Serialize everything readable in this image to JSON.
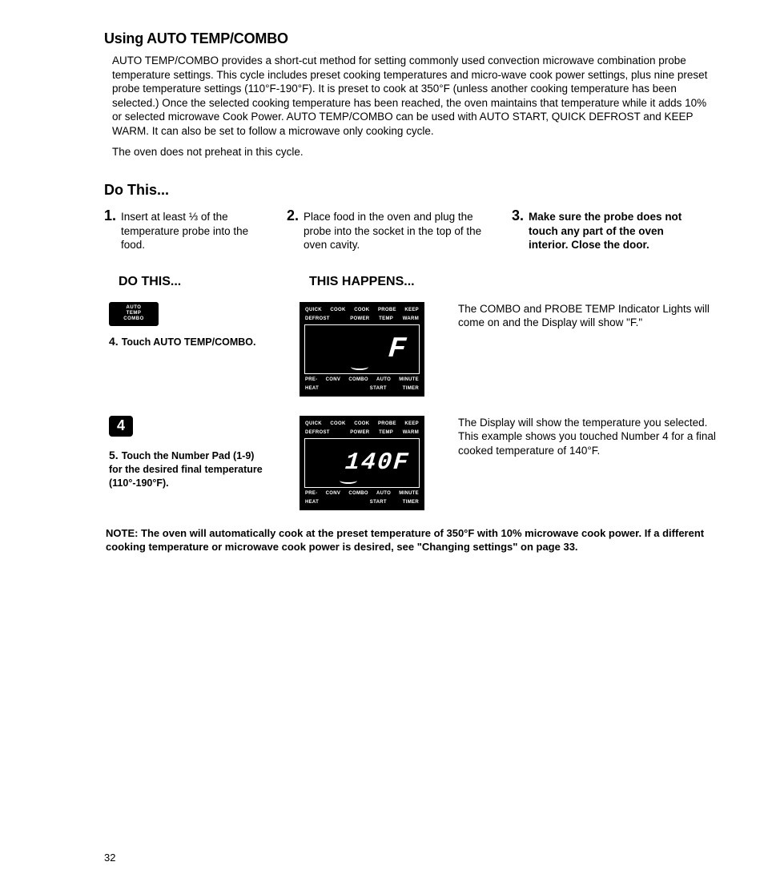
{
  "h1": "Using AUTO TEMP/COMBO",
  "intro": "AUTO TEMP/COMBO provides a short-cut method for setting commonly used convection microwave combination probe temperature settings. This cycle includes preset cooking temperatures and micro-wave cook power settings, plus nine preset probe temperature settings (110°F-190°F). It is preset to cook at 350°F (unless another cooking temperature has been selected.) Once the selected cooking temperature has been reached, the oven maintains that temperature while it adds 10% or selected microwave Cook Power. AUTO TEMP/COMBO can be used with AUTO START, QUICK DEFROST and KEEP WARM. It can also be set to follow a microwave only cooking cycle.",
  "intro2": "The oven does not preheat in this cycle.",
  "h2a": "Do This...",
  "steps": {
    "s1n": "1.",
    "s1": "Insert at least ⅓ of the temperature probe into the food.",
    "s2n": "2.",
    "s2": "Place food in the oven and plug the probe into the socket in the top of the oven cavity.",
    "s3n": "3.",
    "s3": "Make sure the probe does not touch any part of the oven interior. Close the door."
  },
  "colhead": {
    "left": "DO THIS...",
    "right": "THIS HAPPENS..."
  },
  "btn_auto": {
    "l1": "AUTO",
    "l2": "TEMP",
    "l3": "COMBO"
  },
  "s4n": "4.",
  "s4": "Touch AUTO TEMP/COMBO.",
  "display_top": {
    "a": "QUICK",
    "b": "COOK",
    "c": "COOK",
    "d": "PROBE",
    "e": "KEEP"
  },
  "display_top2": {
    "a": "DEFROST",
    "c": "POWER",
    "d": "TEMP",
    "e": "WARM"
  },
  "display_bot": {
    "a": "PRE-",
    "b": "CONV",
    "c": "COMBO",
    "d": "AUTO",
    "e": "MINUTE"
  },
  "display_bot2": {
    "a": "HEAT",
    "d": "START",
    "e": "TIMER"
  },
  "seg1": "F",
  "right1": "The COMBO and PROBE TEMP Indicator Lights will come on and the Display will show \"F.\"",
  "btn_num": "4",
  "s5n": "5.",
  "s5": "Touch the Number Pad (1-9) for the desired final temperature (110°-190°F).",
  "seg2": "140F",
  "right2": "The Display will show the temperature you selected. This example shows you touched Number 4 for a final cooked temperature of 140°F.",
  "note": "NOTE: The oven will automatically cook at the preset temperature of 350°F with 10% microwave cook power. If a different cooking temperature or microwave cook power is desired, see \"Changing settings\" on page 33.",
  "page_num": "32"
}
